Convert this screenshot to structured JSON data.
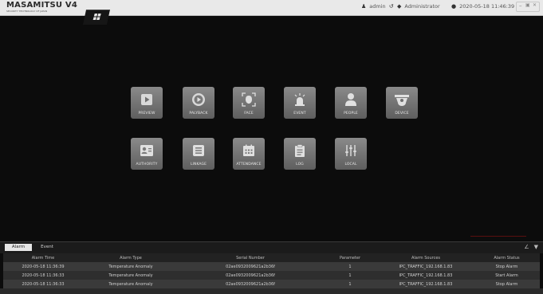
{
  "header": {
    "logo_text": "MASAMITSU V4",
    "logo_sub": "SECURITY TECHNOLOGY OF JAPAN",
    "user": "admin",
    "role": "Administrator",
    "datetime": "2020-05-18 11:46:39"
  },
  "modules": [
    {
      "label": "PREVIEW",
      "icon": "play-icon"
    },
    {
      "label": "PALYBACK",
      "icon": "playback-icon"
    },
    {
      "label": "FACE",
      "icon": "face-icon"
    },
    {
      "label": "EVENT",
      "icon": "alarm-light-icon"
    },
    {
      "label": "PEOPLE",
      "icon": "person-icon"
    },
    {
      "label": "DEVICE",
      "icon": "camera-icon"
    },
    {
      "label": "AUTHORITY",
      "icon": "id-card-icon"
    },
    {
      "label": "LINKAGE",
      "icon": "list-icon"
    },
    {
      "label": "ATTENDANCE",
      "icon": "calendar-icon"
    },
    {
      "label": "LOG",
      "icon": "clipboard-icon"
    },
    {
      "label": "LOCAL",
      "icon": "sliders-icon"
    }
  ],
  "bottom_panel": {
    "tabs": [
      "Alarm",
      "Event"
    ],
    "columns": [
      "Alarm Time",
      "Alarm Type",
      "Serial Number",
      "Parameter",
      "Alarm Sources",
      "Alarm Status"
    ],
    "rows": [
      [
        "2020-05-18 11:36:39",
        "Temperature Anomaly",
        "02ae0932009621a2b36f",
        "1",
        "IPC_TRAFFIC_192.168.1.83",
        "Stop Alarm"
      ],
      [
        "2020-05-18 11:36:33",
        "Temperature Anomaly",
        "02ae0932009621a2b36f",
        "1",
        "IPC_TRAFFIC_192.168.1.83",
        "Start Alarm"
      ],
      [
        "2020-05-18 11:36:33",
        "Temperature Anomaly",
        "02ae0932009621a2b36f",
        "1",
        "IPC_TRAFFIC_192.168.1.83",
        "Stop Alarm"
      ]
    ]
  },
  "colors": {
    "tile": "#747474",
    "background": "#0c0c0c",
    "topbar": "#e9e9e9"
  }
}
